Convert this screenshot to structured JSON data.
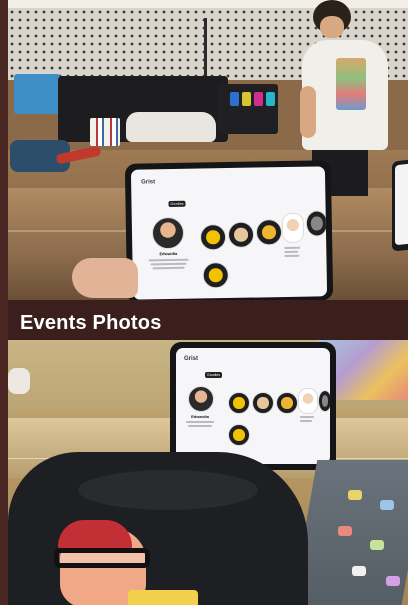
{
  "section": {
    "title": "Events Photos"
  },
  "tablet_app": {
    "logo": "Grist",
    "tabs": [
      "",
      "Goodies",
      ""
    ],
    "profile_name": "Edwardia"
  }
}
